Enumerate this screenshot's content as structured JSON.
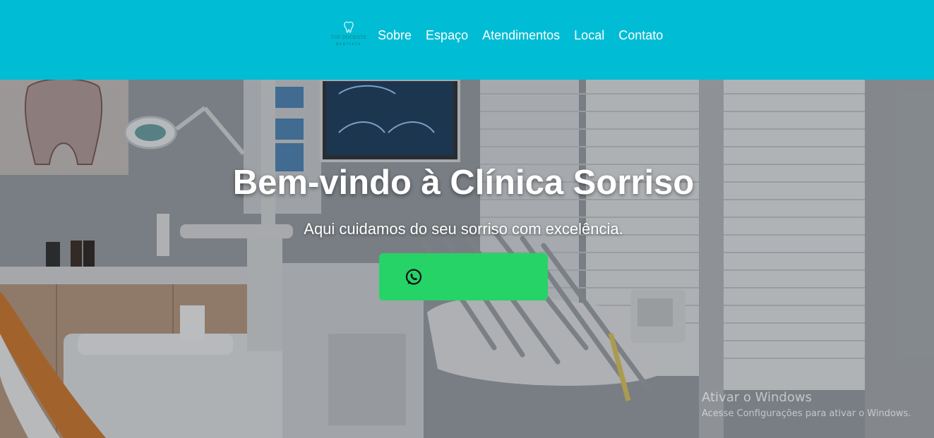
{
  "header": {
    "logo": {
      "name": "TOP DOCENTE",
      "subtitle": "DENTISTA"
    },
    "nav": [
      {
        "label": "Sobre"
      },
      {
        "label": "Espaço"
      },
      {
        "label": "Atendimentos"
      },
      {
        "label": "Local"
      },
      {
        "label": "Contato"
      }
    ]
  },
  "hero": {
    "title": "Bem-vindo à Clínica Sorriso",
    "subtitle": "Aqui cuidamos do seu sorriso com excelência.",
    "cta_icon": "whatsapp-icon",
    "cta_color": "#25d366"
  },
  "watermark": {
    "title": "Ativar o Windows",
    "subtitle": "Acesse Configurações para ativar o Windows."
  },
  "colors": {
    "header_bg": "#00bcd4",
    "text": "#ffffff"
  }
}
